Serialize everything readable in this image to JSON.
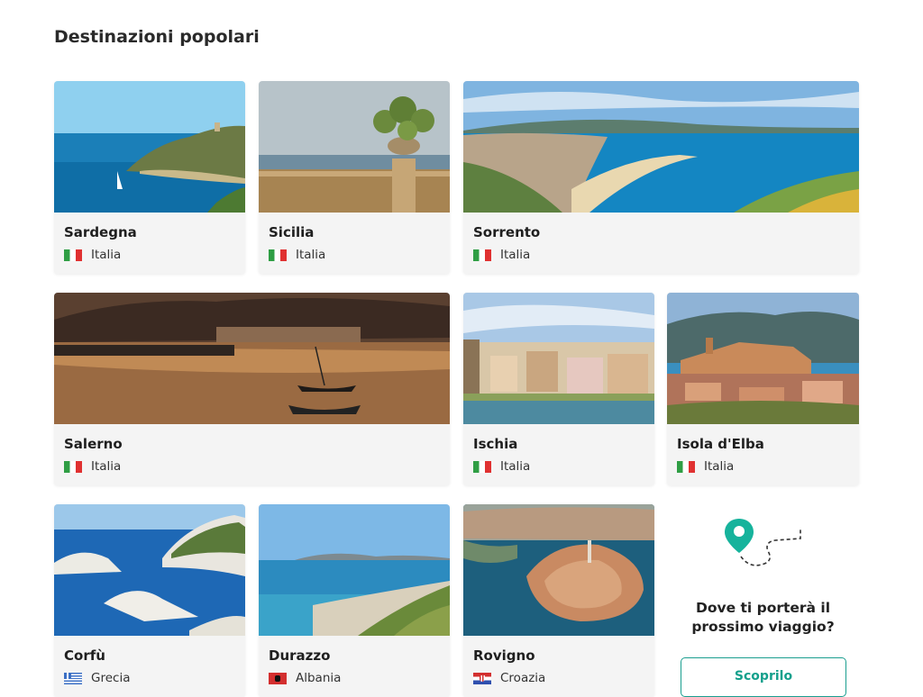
{
  "section": {
    "title": "Destinazioni popolari"
  },
  "destinations": [
    {
      "name": "Sardegna",
      "country": "Italia",
      "flag": "it-flag-icon"
    },
    {
      "name": "Sicilia",
      "country": "Italia",
      "flag": "it-flag-icon"
    },
    {
      "name": "Sorrento",
      "country": "Italia",
      "flag": "it-flag-icon"
    },
    {
      "name": "Salerno",
      "country": "Italia",
      "flag": "it-flag-icon"
    },
    {
      "name": "Ischia",
      "country": "Italia",
      "flag": "it-flag-icon"
    },
    {
      "name": "Isola d'Elba",
      "country": "Italia",
      "flag": "it-flag-icon"
    },
    {
      "name": "Corfù",
      "country": "Grecia",
      "flag": "gr-flag-icon"
    },
    {
      "name": "Durazzo",
      "country": "Albania",
      "flag": "al-flag-icon"
    },
    {
      "name": "Rovigno",
      "country": "Croazia",
      "flag": "hr-flag-icon"
    }
  ],
  "promo": {
    "question": "Dove ti porterà il prossimo viaggio?",
    "button_label": "Scoprilo",
    "icon": "map-pin-route-icon"
  },
  "colors": {
    "accent": "#14a08c",
    "card_bg": "#f4f4f4"
  }
}
